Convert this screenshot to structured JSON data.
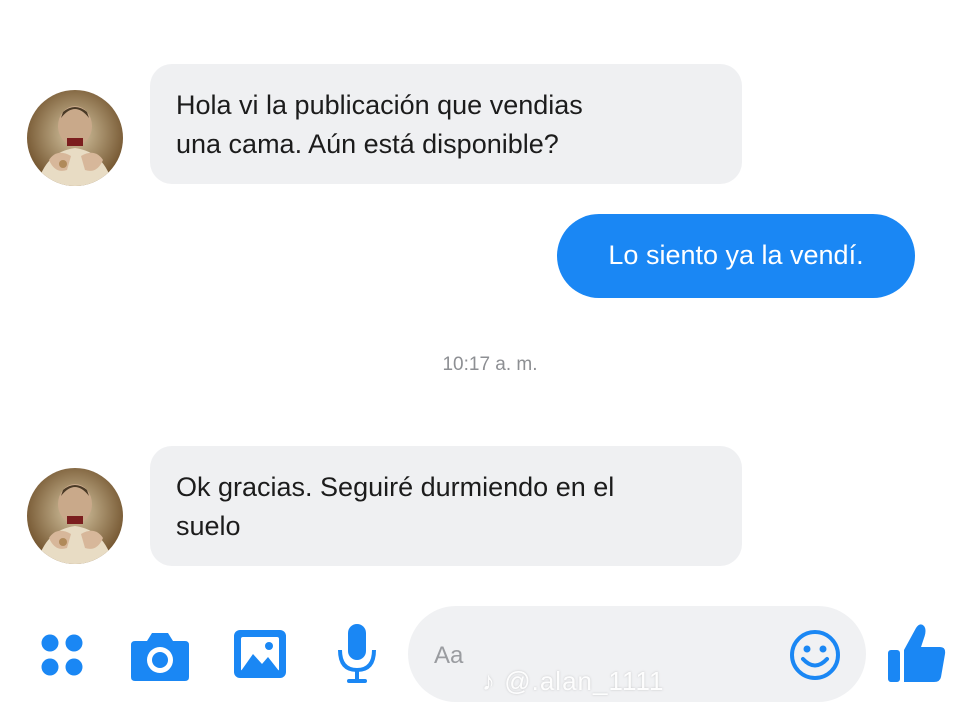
{
  "conversation": {
    "messages": [
      {
        "sender": "contact",
        "lines": [
          "Hola vi la publicación que vendias",
          "una cama. Aún está disponible?"
        ]
      },
      {
        "sender": "me",
        "text": "Lo siento ya la vendí."
      },
      {
        "sender": "contact",
        "lines": [
          "Ok gracias. Seguiré durmiendo en el",
          "suelo"
        ]
      }
    ],
    "timestamp": "10:17 a. m."
  },
  "composer": {
    "placeholder": "Aa"
  },
  "toolbar": {
    "icons": [
      "apps-icon",
      "camera-icon",
      "image-icon",
      "microphone-icon",
      "emoji-icon",
      "like-icon"
    ]
  },
  "watermark": {
    "text": "@.alan_1111"
  },
  "colors": {
    "accent": "#1a87f4",
    "incoming_bubble": "#eff0f2",
    "outgoing_text": "#ffffff",
    "timestamp": "#8d8f93"
  }
}
